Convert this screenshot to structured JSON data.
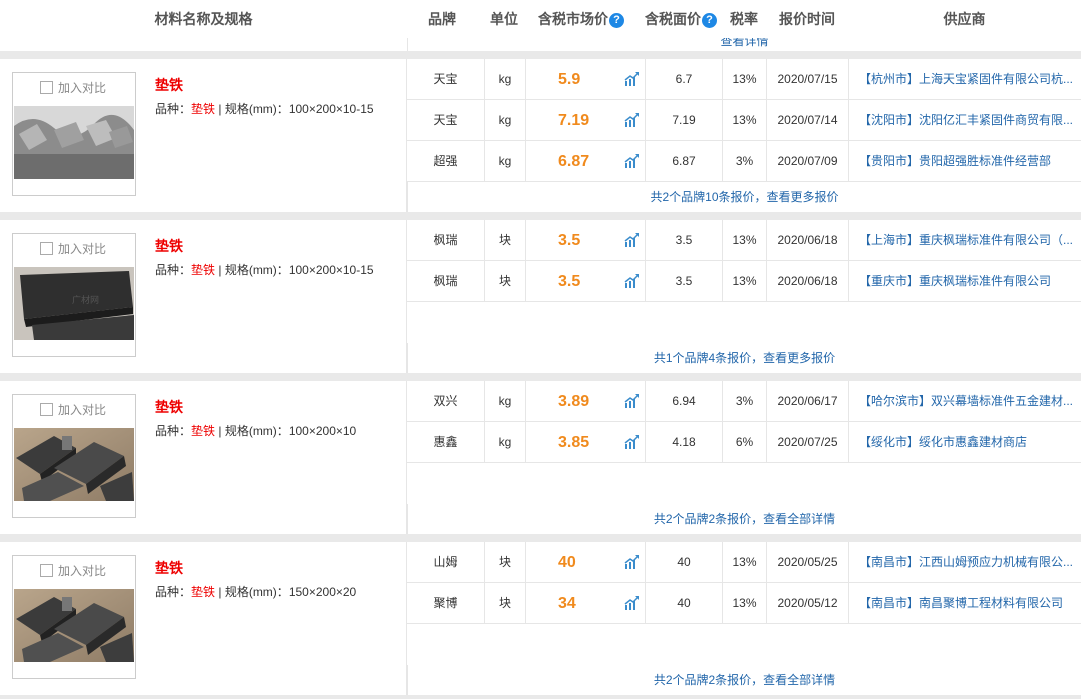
{
  "columns": {
    "name": "材料名称及规格",
    "brand": "品牌",
    "unit": "单位",
    "market_price": "含税市场价",
    "face_price": "含税面价",
    "tax": "税率",
    "date": "报价时间",
    "supplier": "供应商",
    "help_symbol": "?"
  },
  "peek_link": "查看详情",
  "compare_label": "加入对比",
  "spec_prefix": "品种：",
  "spec_sep": " | 规格(mm)：",
  "colors": {
    "price": "#f08a1d",
    "link": "#2266aa",
    "name": "#ee0000",
    "help": "#1e88e5"
  },
  "products": [
    {
      "name": "垫铁",
      "variety": "垫铁",
      "spec": "100×200×10-15",
      "image": "gray-metal-shims",
      "rows": [
        {
          "brand": "天宝",
          "unit": "kg",
          "price": "5.9",
          "face": "6.7",
          "tax": "13%",
          "date": "2020/07/15",
          "supplier": "【杭州市】上海天宝紧固件有限公司杭..."
        },
        {
          "brand": "天宝",
          "unit": "kg",
          "price": "7.19",
          "face": "7.19",
          "tax": "13%",
          "date": "2020/07/14",
          "supplier": "【沈阳市】沈阳亿汇丰紧固件商贸有限..."
        },
        {
          "brand": "超强",
          "unit": "kg",
          "price": "6.87",
          "face": "6.87",
          "tax": "3%",
          "date": "2020/07/09",
          "supplier": "【贵阳市】贵阳超强胜标准件经营部"
        }
      ],
      "more": "共2个品牌10条报价，查看更多报价"
    },
    {
      "name": "垫铁",
      "variety": "垫铁",
      "spec": "100×200×10-15",
      "image": "black-steel-plate",
      "rows": [
        {
          "brand": "枫瑞",
          "unit": "块",
          "price": "3.5",
          "face": "3.5",
          "tax": "13%",
          "date": "2020/06/18",
          "supplier": "【上海市】重庆枫瑞标准件有限公司（..."
        },
        {
          "brand": "枫瑞",
          "unit": "块",
          "price": "3.5",
          "face": "3.5",
          "tax": "13%",
          "date": "2020/06/18",
          "supplier": "【重庆市】重庆枫瑞标准件有限公司"
        }
      ],
      "more": "共1个品牌4条报价，查看更多报价"
    },
    {
      "name": "垫铁",
      "variety": "垫铁",
      "spec": "100×200×10",
      "image": "stacked-shims",
      "rows": [
        {
          "brand": "双兴",
          "unit": "kg",
          "price": "3.89",
          "face": "6.94",
          "tax": "3%",
          "date": "2020/06/17",
          "supplier": "【哈尔滨市】双兴幕墙标准件五金建材..."
        },
        {
          "brand": "惠鑫",
          "unit": "kg",
          "price": "3.85",
          "face": "4.18",
          "tax": "6%",
          "date": "2020/07/25",
          "supplier": "【绥化市】绥化市惠鑫建材商店"
        }
      ],
      "more": "共2个品牌2条报价，查看全部详情"
    },
    {
      "name": "垫铁",
      "variety": "垫铁",
      "spec": "150×200×20",
      "image": "stacked-shims",
      "rows": [
        {
          "brand": "山姆",
          "unit": "块",
          "price": "40",
          "face": "40",
          "tax": "13%",
          "date": "2020/05/25",
          "supplier": "【南昌市】江西山姆预应力机械有限公..."
        },
        {
          "brand": "聚博",
          "unit": "块",
          "price": "34",
          "face": "40",
          "tax": "13%",
          "date": "2020/05/12",
          "supplier": "【南昌市】南昌聚博工程材料有限公司"
        }
      ],
      "more": "共2个品牌2条报价，查看全部详情"
    }
  ]
}
